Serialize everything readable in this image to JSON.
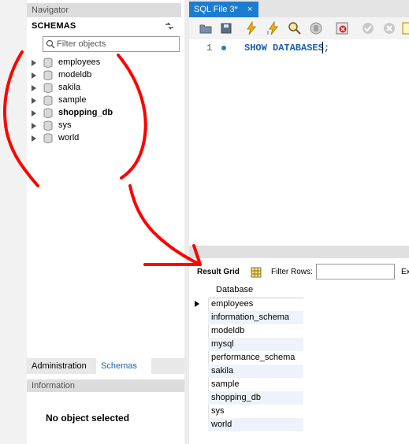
{
  "navigator": {
    "title": "Navigator",
    "schemas_label": "SCHEMAS",
    "filter_placeholder": "Filter objects",
    "schemas": [
      {
        "name": "employees",
        "bold": false
      },
      {
        "name": "modeldb",
        "bold": false
      },
      {
        "name": "sakila",
        "bold": false
      },
      {
        "name": "sample",
        "bold": false
      },
      {
        "name": "shopping_db",
        "bold": true
      },
      {
        "name": "sys",
        "bold": false
      },
      {
        "name": "world",
        "bold": false
      }
    ]
  },
  "bottom_tabs": {
    "administration": "Administration",
    "schemas": "Schemas"
  },
  "information": {
    "title": "Information",
    "message": "No object selected"
  },
  "editor": {
    "tab_title": "SQL File 3*",
    "tab_close": "×",
    "line_number": "1",
    "code": "SHOW DATABASES;"
  },
  "results": {
    "result_grid_label": "Result Grid",
    "filter_rows_label": "Filter Rows:",
    "export_label": "Ex",
    "column_header": "Database",
    "rows": [
      "employees",
      "information_schema",
      "modeldb",
      "mysql",
      "performance_schema",
      "sakila",
      "sample",
      "shopping_db",
      "sys",
      "world"
    ]
  },
  "colors": {
    "tab_active": "#1c7dd0",
    "link_blue": "#1f5fa8",
    "annotation_red": "#ff0000",
    "row_alt": "#eef3fb"
  }
}
